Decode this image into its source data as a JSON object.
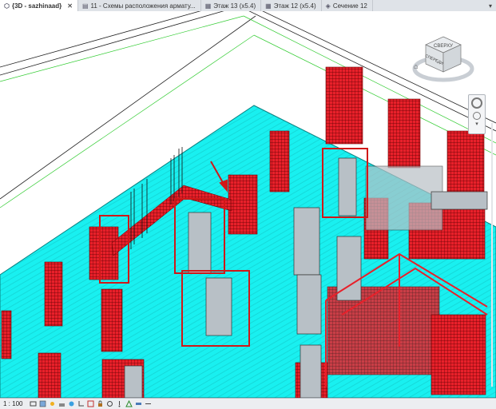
{
  "tabs": [
    {
      "label": "{3D - sazhinaad}",
      "icon": "3d-view-icon",
      "closable": true,
      "active": true
    },
    {
      "label": "11 - Схемы расположения армату...",
      "icon": "sheet-icon",
      "closable": false,
      "active": false
    },
    {
      "label": "Этаж 13 (x5.4)",
      "icon": "plan-view-icon",
      "closable": false,
      "active": false
    },
    {
      "label": "Этаж 12 (x5.4)",
      "icon": "plan-view-icon",
      "closable": false,
      "active": false
    },
    {
      "label": "Сечение 12",
      "icon": "section-view-icon",
      "closable": false,
      "active": false
    }
  ],
  "viewcube": {
    "top_label": "СВЕРХУ",
    "front_label": "СПЕРЕДИ"
  },
  "statusbar": {
    "scale": "1 : 100"
  },
  "colors": {
    "slab": "#19f0f0",
    "rebar": "#e8202a",
    "highlight": "#d01818",
    "grid": "#33cc33",
    "concrete": "#b8c0c6"
  }
}
